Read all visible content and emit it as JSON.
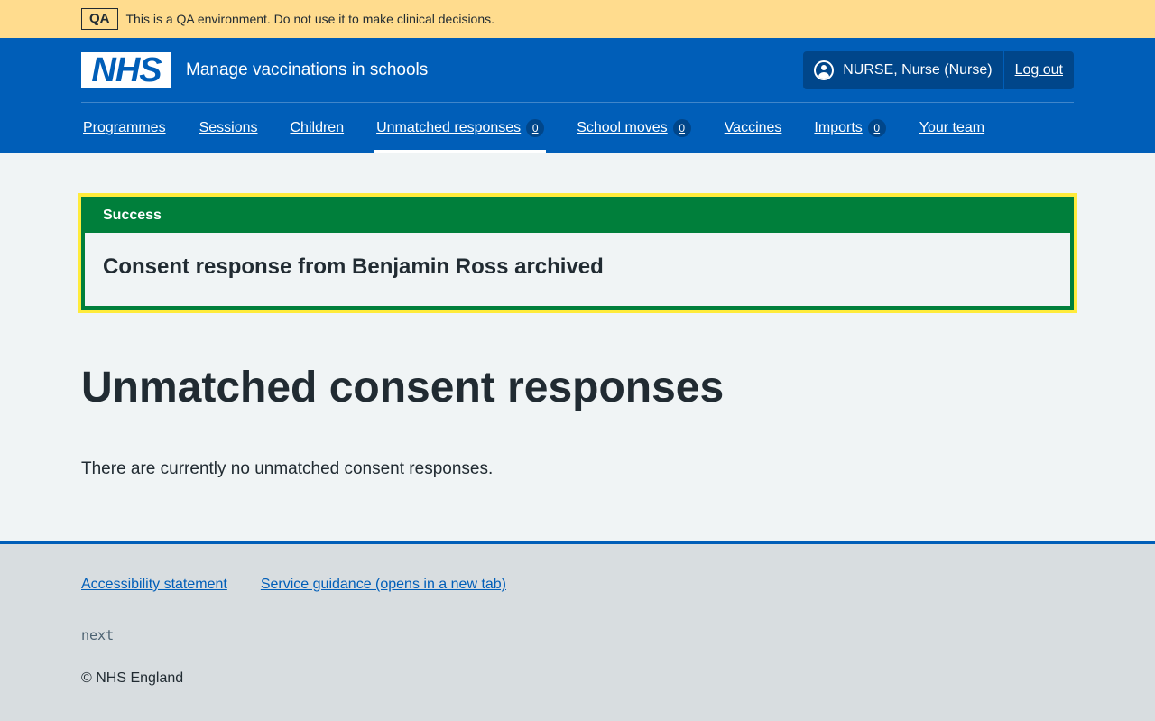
{
  "qa_banner": {
    "tag": "QA",
    "text": "This is a QA environment. Do not use it to make clinical decisions."
  },
  "header": {
    "logo": "NHS",
    "service_name": "Manage vaccinations in schools",
    "user": "NURSE, Nurse (Nurse)",
    "logout": "Log out"
  },
  "nav": {
    "items": [
      {
        "label": "Programmes"
      },
      {
        "label": "Sessions"
      },
      {
        "label": "Children"
      },
      {
        "label": "Unmatched responses",
        "count": "0"
      },
      {
        "label": "School moves",
        "count": "0"
      },
      {
        "label": "Vaccines"
      },
      {
        "label": "Imports",
        "count": "0"
      },
      {
        "label": "Your team"
      }
    ]
  },
  "success": {
    "title": "Success",
    "message": "Consent response from Benjamin Ross archived"
  },
  "main": {
    "heading": "Unmatched consent responses",
    "body": "There are currently no unmatched consent responses."
  },
  "footer": {
    "links": [
      "Accessibility statement",
      "Service guidance (opens in a new tab)"
    ],
    "version": "next",
    "copyright": "© NHS England"
  }
}
